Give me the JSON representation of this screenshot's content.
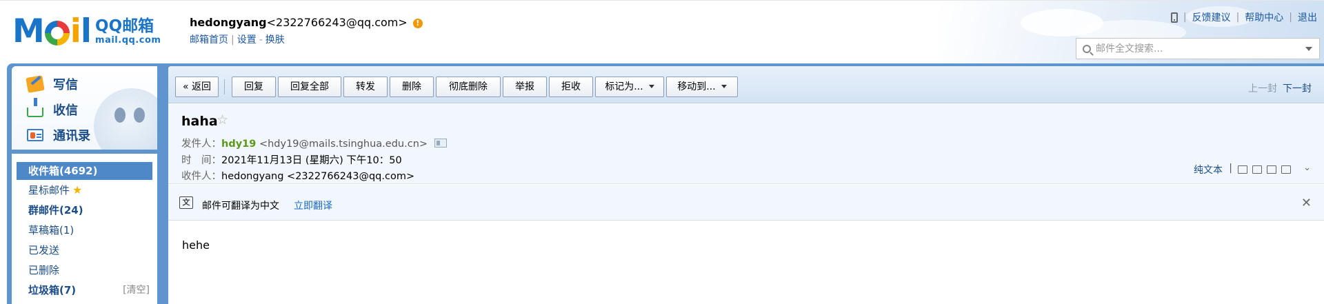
{
  "header": {
    "logo_brand": "QQ邮箱",
    "logo_domain": "mail.qq.com",
    "account_nick": "hedongyang",
    "account_email": "<2322766243@qq.com>",
    "links": {
      "home": "邮箱首页",
      "sep1": "|",
      "settings": "设置",
      "dash": "-",
      "skin": "换肤"
    },
    "toplinks": {
      "feedback": "反馈建议",
      "help": "帮助中心",
      "logout": "退出",
      "sep": "|"
    },
    "search_placeholder": "邮件全文搜索..."
  },
  "sidebar": {
    "actions": [
      {
        "label": "写信",
        "icon": "compose-icon"
      },
      {
        "label": "收信",
        "icon": "inbox-download-icon"
      },
      {
        "label": "通讯录",
        "icon": "contacts-icon"
      }
    ],
    "folders": [
      {
        "label": "收件箱(4692)",
        "active": true
      },
      {
        "label": "星标邮件"
      },
      {
        "label": "群邮件(24)"
      },
      {
        "label": "草稿箱(1)"
      },
      {
        "label": "已发送"
      },
      {
        "label": "已删除"
      },
      {
        "label": "垃圾箱(7)",
        "extra": "[清空]"
      }
    ]
  },
  "toolbar": {
    "back": "« 返回",
    "reply": "回复",
    "reply_all": "回复全部",
    "forward": "转发",
    "delete": "删除",
    "delete_forever": "彻底删除",
    "report": "举报",
    "reject": "拒收",
    "mark_as": "标记为...",
    "move_to": "移动到...",
    "prev": "上一封",
    "next": "下一封"
  },
  "message": {
    "subject": "haha",
    "star": "☆",
    "from_label": "发件人：",
    "from_name": "hdy19",
    "from_addr": "<hdy19@mails.tsinghua.edu.cn>",
    "time_label": "时　间：",
    "time_value": "2021年11月13日 (星期六) 下午10：50",
    "to_label": "收件人：",
    "to_value": "hedongyang <2322766243@qq.com>",
    "plain_text": "纯文本",
    "plain_sep": "|",
    "translate_icon": "文",
    "translate_text": "邮件可翻译为中文",
    "translate_link": "立即翻译",
    "close": "✕",
    "expand": "⌄",
    "body": "hehe"
  },
  "colors": {
    "brand_blue": "#1a74c8",
    "frame_blue": "#5f95cf",
    "sender_green": "#5a9a18",
    "active_folder": "#4f88c8"
  }
}
